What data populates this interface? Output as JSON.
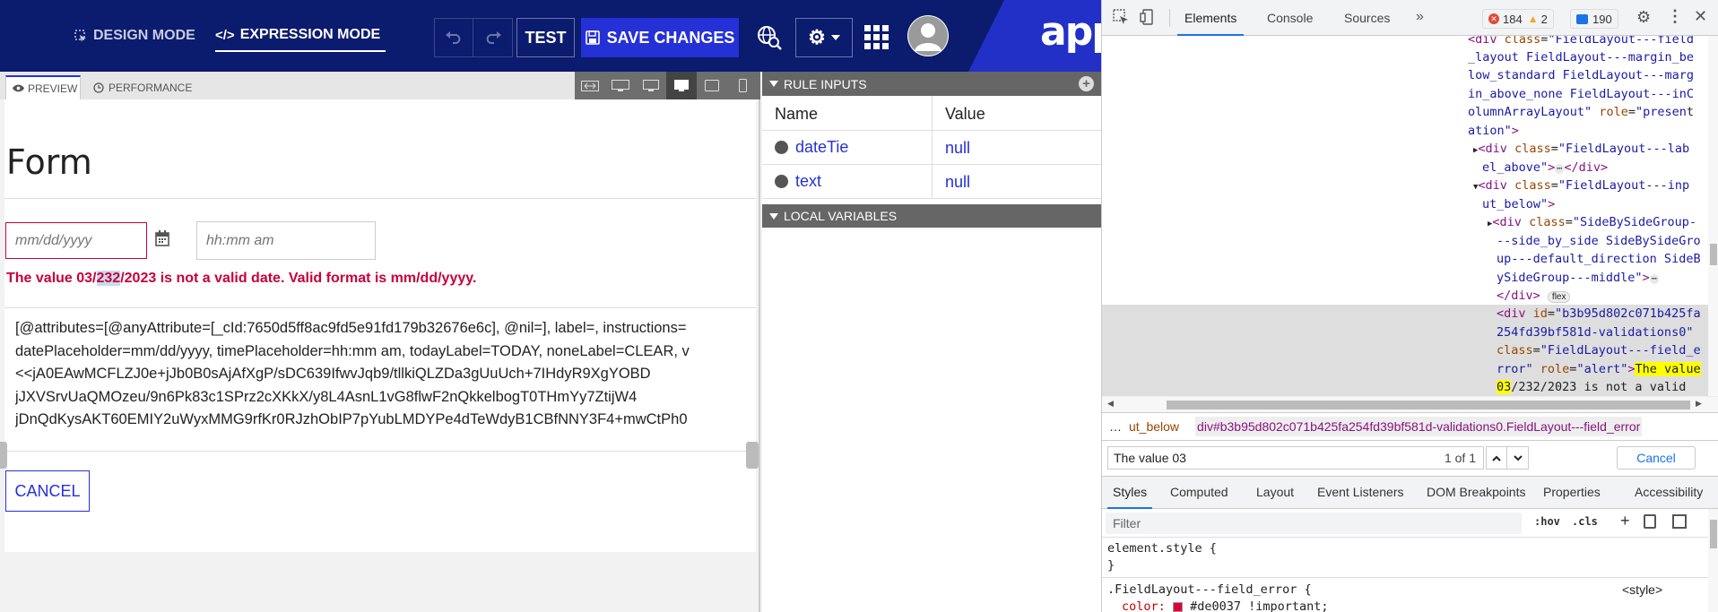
{
  "toolbar": {
    "design_mode": "DESIGN MODE",
    "expression_mode": "EXPRESSION MODE",
    "test": "TEST",
    "save_changes": "SAVE CHANGES",
    "logo": "app"
  },
  "preview_tabs": {
    "preview": "PREVIEW",
    "performance": "PERFORMANCE"
  },
  "form": {
    "title": "Form",
    "date_placeholder": "mm/dd/yyyy",
    "time_placeholder": "hh:mm am",
    "error_before": "The value 03/",
    "error_highlight": "232",
    "error_after": "/2023 is not a valid date. Valid format is mm/dd/yyyy.",
    "debug_lines": [
      "[@attributes=[@anyAttribute=[_cId:7650d5ff8ac9fd5e91fd179b32676e6c], @nil=], label=, instructions=",
      "datePlaceholder=mm/dd/yyyy, timePlaceholder=hh:mm am, todayLabel=TODAY, noneLabel=CLEAR, v",
      "<<jA0EAwMCFLZJ0e+jJb0B0sAjAfXgP/sDC639IfwvJqb9/tllkiQLZDa3gUuUch+7IHdyR9XgYOBD",
      "jJXVSrvUaQMOzeu/9n6Pk83c1SPrz2cXKkX/y8L4AsnL1vG8flwF2nQkkelbogT0THmYy7ZtijW4",
      "jDnQdKysAKT60EMIY2uWyxMMG9rfKr0RJzhObIP7pYubLMDYPe4dTeWdyB1CBfNNY3F4+mwCtPh0"
    ],
    "cancel": "CANCEL"
  },
  "rule_inputs": {
    "title": "RULE INPUTS",
    "col_name": "Name",
    "col_value": "Value",
    "rows": [
      {
        "name": "dateTie",
        "value": "null"
      },
      {
        "name": "text",
        "value": "null"
      }
    ]
  },
  "local_variables": {
    "title": "LOCAL VARIABLES"
  },
  "devtools": {
    "tabs": [
      "Elements",
      "Console",
      "Sources"
    ],
    "error_count": "184",
    "warning_count": "2",
    "info_count": "190",
    "breadcrumb_left": "ut_below",
    "breadcrumb_main": "div#b3b95d802c071b425fa254fd39bf581d-validations0.FieldLayout---field_error",
    "search_value": "The value 03",
    "search_count": "1 of 1",
    "search_cancel": "Cancel",
    "style_tabs": [
      "Styles",
      "Computed",
      "Layout",
      "Event Listeners",
      "DOM Breakpoints",
      "Properties",
      "Accessibility"
    ],
    "filter_placeholder": "Filter",
    "hov": ":hov",
    "cls": ".cls",
    "flex_badge": "flex",
    "style_rule_1": "element.style {",
    "style_close": "}",
    "style_rule_2": ".FieldLayout---field_error {",
    "style_source": "<style>",
    "style_prop": "color:",
    "style_value": "#de0037 !important;",
    "error_color": "#de0037"
  }
}
